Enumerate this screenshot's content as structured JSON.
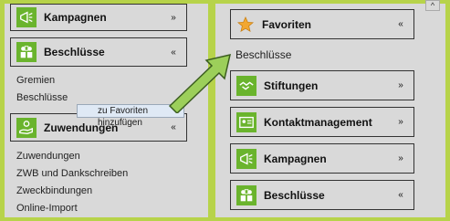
{
  "left": {
    "panels": [
      {
        "label": "Kampagnen",
        "chevron": "»"
      },
      {
        "label": "Beschlüsse",
        "chevron": "«"
      },
      {
        "label": "Zuwendungen",
        "chevron": "«"
      }
    ],
    "beschluesse_links": [
      "Gremien",
      "Beschlüsse"
    ],
    "zuwendungen_links": [
      "Zuwendungen",
      "ZWB und Dankschreiben",
      "Zweckbindungen",
      "Online-Import"
    ]
  },
  "tooltip": {
    "text": "zu Favoriten hinzufügen"
  },
  "right": {
    "favoriten": {
      "label": "Favoriten",
      "chevron": "«"
    },
    "favorite_item": "Beschlüsse",
    "panels": [
      {
        "label": "Stiftungen",
        "chevron": "»"
      },
      {
        "label": "Kontaktmanagement",
        "chevron": "»"
      },
      {
        "label": "Kampagnen",
        "chevron": "»"
      },
      {
        "label": "Beschlüsse",
        "chevron": "«"
      }
    ]
  },
  "scroll_up_glyph": "^",
  "colors": {
    "accent": "#6ab42d",
    "frame": "#b7d34a",
    "arrow": "#9ccf5a"
  }
}
